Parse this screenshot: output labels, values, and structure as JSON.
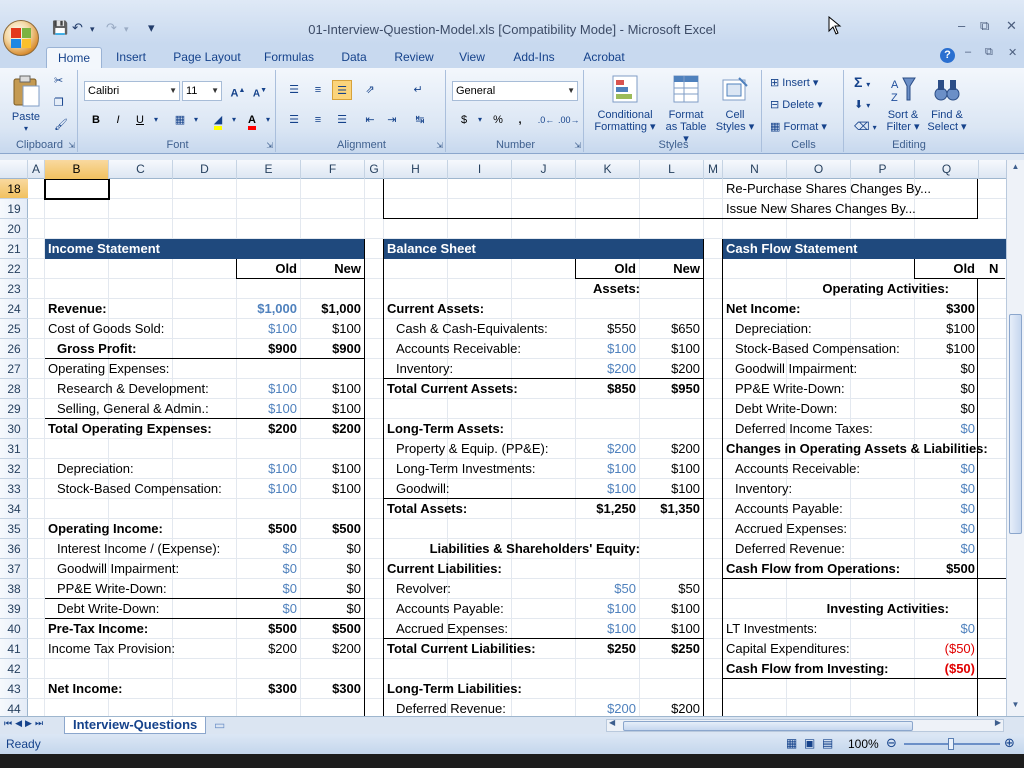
{
  "window": {
    "title": "01-Interview-Question-Model.xls  [Compatibility Mode] - Microsoft Excel",
    "minimize": "–",
    "restore": "⧉",
    "close": "✕"
  },
  "qat": {
    "save_icon": "save-icon",
    "undo_icon": "undo-icon",
    "redo_icon": "redo-icon",
    "customize": "▾"
  },
  "tabs": [
    "Home",
    "Insert",
    "Page Layout",
    "Formulas",
    "Data",
    "Review",
    "View",
    "Add-Ins",
    "Acrobat"
  ],
  "active_tab": "Home",
  "ribbon": {
    "clipboard": {
      "label": "Clipboard",
      "paste": "Paste"
    },
    "font": {
      "label": "Font",
      "name": "Calibri",
      "size": "11",
      "bold": "B",
      "italic": "I",
      "underline": "U"
    },
    "alignment": {
      "label": "Alignment"
    },
    "number": {
      "label": "Number",
      "format": "General",
      "currency": "$",
      "percent": "%",
      "comma": ","
    },
    "styles": {
      "label": "Styles",
      "conditional": "Conditional",
      "conditional2": "Formatting",
      "format_table": "Format",
      "format_table2": "as Table",
      "cell_styles": "Cell",
      "cell_styles2": "Styles"
    },
    "cells": {
      "label": "Cells",
      "insert": "Insert",
      "delete": "Delete",
      "format": "Format"
    },
    "editing": {
      "label": "Editing",
      "sort": "Sort &",
      "sort2": "Filter",
      "find": "Find &",
      "find2": "Select",
      "sigma": "Σ"
    }
  },
  "columns": [
    "A",
    "B",
    "C",
    "D",
    "E",
    "F",
    "G",
    "H",
    "I",
    "J",
    "K",
    "L",
    "M",
    "N",
    "O",
    "P",
    "Q"
  ],
  "selected_column": "B",
  "rows": [
    "18",
    "19",
    "20",
    "21",
    "22",
    "23",
    "24",
    "25",
    "26",
    "27",
    "28",
    "29",
    "30",
    "31",
    "32",
    "33",
    "34",
    "35",
    "36",
    "37",
    "38",
    "39",
    "40",
    "41",
    "42",
    "43",
    "44"
  ],
  "selected_row": "18",
  "top_right": [
    "Re-Purchase Shares Changes By...",
    "Issue New Shares Changes By..."
  ],
  "income": {
    "header": "Income Statement",
    "old": "Old",
    "new": "New",
    "rows": [
      {
        "label": "Revenue:",
        "old": "$1,000",
        "new": "$1,000",
        "bold": true,
        "indent": 0,
        "oldblue": true
      },
      {
        "label": "Cost of Goods Sold:",
        "old": "$100",
        "new": "$100",
        "indent": 0,
        "oldblue": true
      },
      {
        "label": "Gross Profit:",
        "old": "$900",
        "new": "$900",
        "bold": true,
        "indent": 1
      },
      {
        "label": "Operating Expenses:",
        "old": "",
        "new": "",
        "indent": 0
      },
      {
        "label": "Research & Development:",
        "old": "$100",
        "new": "$100",
        "indent": 1,
        "oldblue": true
      },
      {
        "label": "Selling, General & Admin.:",
        "old": "$100",
        "new": "$100",
        "indent": 1,
        "oldblue": true
      },
      {
        "label": "Total Operating Expenses:",
        "old": "$200",
        "new": "$200",
        "bold": true,
        "indent": 0
      },
      {
        "label": "",
        "old": "",
        "new": ""
      },
      {
        "label": "Depreciation:",
        "old": "$100",
        "new": "$100",
        "indent": 1,
        "oldblue": true
      },
      {
        "label": "Stock-Based Compensation:",
        "old": "$100",
        "new": "$100",
        "indent": 1,
        "oldblue": true
      },
      {
        "label": "",
        "old": "",
        "new": ""
      },
      {
        "label": "Operating Income:",
        "old": "$500",
        "new": "$500",
        "bold": true,
        "indent": 0
      },
      {
        "label": "Interest Income / (Expense):",
        "old": "$0",
        "new": "$0",
        "indent": 1,
        "oldblue": true
      },
      {
        "label": "Goodwill Impairment:",
        "old": "$0",
        "new": "$0",
        "indent": 1,
        "oldblue": true
      },
      {
        "label": "PP&E Write-Down:",
        "old": "$0",
        "new": "$0",
        "indent": 1,
        "oldblue": true
      },
      {
        "label": "Debt Write-Down:",
        "old": "$0",
        "new": "$0",
        "indent": 1,
        "oldblue": true
      },
      {
        "label": "Pre-Tax Income:",
        "old": "$500",
        "new": "$500",
        "bold": true,
        "indent": 0
      },
      {
        "label": "Income Tax Provision:",
        "old": "$200",
        "new": "$200",
        "indent": 0
      },
      {
        "label": "",
        "old": "",
        "new": ""
      },
      {
        "label": "Net Income:",
        "old": "$300",
        "new": "$300",
        "bold": true,
        "indent": 0
      }
    ]
  },
  "balance": {
    "header": "Balance Sheet",
    "old": "Old",
    "new": "New",
    "rows": [
      {
        "label": "Assets:",
        "old": "",
        "new": "",
        "bold": true,
        "center": true
      },
      {
        "label": "Current Assets:",
        "old": "",
        "new": "",
        "bold": true,
        "indent": 0
      },
      {
        "label": "Cash & Cash-Equivalents:",
        "old": "$550",
        "new": "$650",
        "indent": 1
      },
      {
        "label": "Accounts Receivable:",
        "old": "$100",
        "new": "$100",
        "indent": 1,
        "oldblue": true
      },
      {
        "label": "Inventory:",
        "old": "$200",
        "new": "$200",
        "indent": 1,
        "oldblue": true
      },
      {
        "label": "Total Current Assets:",
        "old": "$850",
        "new": "$950",
        "bold": true,
        "indent": 0
      },
      {
        "label": "",
        "old": "",
        "new": ""
      },
      {
        "label": "Long-Term Assets:",
        "old": "",
        "new": "",
        "bold": true,
        "indent": 0
      },
      {
        "label": "Property & Equip. (PP&E):",
        "old": "$200",
        "new": "$200",
        "indent": 1,
        "oldblue": true
      },
      {
        "label": "Long-Term Investments:",
        "old": "$100",
        "new": "$100",
        "indent": 1,
        "oldblue": true
      },
      {
        "label": "Goodwill:",
        "old": "$100",
        "new": "$100",
        "indent": 1,
        "oldblue": true
      },
      {
        "label": "Total Assets:",
        "old": "$1,250",
        "new": "$1,350",
        "bold": true,
        "indent": 0
      },
      {
        "label": "",
        "old": "",
        "new": ""
      },
      {
        "label": "Liabilities & Shareholders' Equity:",
        "old": "",
        "new": "",
        "bold": true,
        "center": true
      },
      {
        "label": "Current Liabilities:",
        "old": "",
        "new": "",
        "bold": true,
        "indent": 0
      },
      {
        "label": "Revolver:",
        "old": "$50",
        "new": "$50",
        "indent": 1,
        "oldblue": true
      },
      {
        "label": "Accounts Payable:",
        "old": "$100",
        "new": "$100",
        "indent": 1,
        "oldblue": true
      },
      {
        "label": "Accrued Expenses:",
        "old": "$100",
        "new": "$100",
        "indent": 1,
        "oldblue": true
      },
      {
        "label": "Total Current Liabilities:",
        "old": "$250",
        "new": "$250",
        "bold": true,
        "indent": 0
      },
      {
        "label": "",
        "old": "",
        "new": ""
      },
      {
        "label": "Long-Term Liabilities:",
        "old": "",
        "new": "",
        "bold": true,
        "indent": 0
      },
      {
        "label": "Deferred Revenue:",
        "old": "$200",
        "new": "$200",
        "indent": 1,
        "oldblue": true
      }
    ]
  },
  "cashflow": {
    "header": "Cash Flow Statement",
    "old": "Old",
    "new": "N",
    "rows": [
      {
        "label": "Operating Activities:",
        "old": "",
        "bold": true,
        "center": true
      },
      {
        "label": "Net Income:",
        "old": "$300",
        "bold": true,
        "indent": 0
      },
      {
        "label": "Depreciation:",
        "old": "$100",
        "indent": 1
      },
      {
        "label": "Stock-Based Compensation:",
        "old": "$100",
        "indent": 1
      },
      {
        "label": "Goodwill Impairment:",
        "old": "$0",
        "indent": 1
      },
      {
        "label": "PP&E Write-Down:",
        "old": "$0",
        "indent": 1
      },
      {
        "label": "Debt Write-Down:",
        "old": "$0",
        "indent": 1
      },
      {
        "label": "Deferred Income Taxes:",
        "old": "$0",
        "indent": 1,
        "oldblue": true
      },
      {
        "label": "Changes in Operating Assets & Liabilities:",
        "old": "",
        "bold": true,
        "indent": 0
      },
      {
        "label": "Accounts Receivable:",
        "old": "$0",
        "indent": 1,
        "oldblue": true
      },
      {
        "label": "Inventory:",
        "old": "$0",
        "indent": 1,
        "oldblue": true
      },
      {
        "label": "Accounts Payable:",
        "old": "$0",
        "indent": 1,
        "oldblue": true
      },
      {
        "label": "Accrued Expenses:",
        "old": "$0",
        "indent": 1,
        "oldblue": true
      },
      {
        "label": "Deferred Revenue:",
        "old": "$0",
        "indent": 1,
        "oldblue": true
      },
      {
        "label": "Cash Flow from Operations:",
        "old": "$500",
        "bold": true,
        "indent": 0
      },
      {
        "label": "",
        "old": ""
      },
      {
        "label": "Investing Activities:",
        "old": "",
        "bold": true,
        "center": true
      },
      {
        "label": "LT Investments:",
        "old": "$0",
        "indent": 0,
        "oldblue": true
      },
      {
        "label": "Capital Expenditures:",
        "old": "($50)",
        "indent": 0,
        "oldred": true
      },
      {
        "label": "Cash Flow from Investing:",
        "old": "($50)",
        "bold": true,
        "indent": 0,
        "oldred": true
      }
    ]
  },
  "sheet_tab": "Interview-Questions",
  "status": {
    "ready": "Ready",
    "zoom": "100%"
  }
}
